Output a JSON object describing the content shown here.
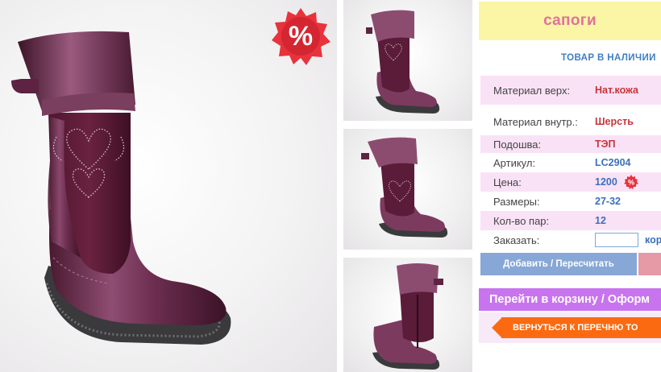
{
  "product": {
    "title": "сапоги",
    "stock_status": "ТОВАР В НАЛИЧИИ",
    "sale_badge": "%",
    "specs": [
      {
        "label": "Материал верх:",
        "value": "Нат.кожа"
      },
      {
        "label": "Материал внутр.:",
        "value": "Шерсть"
      },
      {
        "label": "Подошва:",
        "value": "ТЭП"
      },
      {
        "label": "Артикул:",
        "value": "LC2904"
      },
      {
        "label": "Цена:",
        "value": "1200"
      },
      {
        "label": "Размеры:",
        "value": "27-32"
      },
      {
        "label": "Кол-во пар:",
        "value": "12"
      }
    ],
    "order": {
      "label": "Заказать:",
      "value": "",
      "unit": "кор"
    }
  },
  "actions": {
    "update_label": "Добавить / Пересчитать",
    "cart_label": "Перейти в корзину / Оформ",
    "back_label": "ВЕРНУТЬСЯ К ПЕРЕЧНЮ ТО"
  },
  "icons": {
    "sale": "percent-badge-icon"
  },
  "colors": {
    "title_bg": "#fbf6a6",
    "title_text": "#e2709a",
    "accent_blue": "#3d6fbd",
    "accent_red": "#c8343a",
    "cart_button": "#c774ee",
    "back_button": "#fb6a10",
    "update_button": "#87a7d6",
    "badge_red": "#e8323c"
  }
}
